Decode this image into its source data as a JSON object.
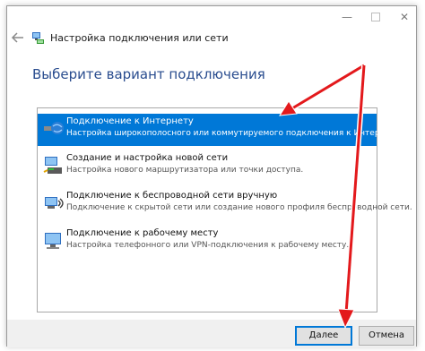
{
  "window": {
    "title": "Настройка подключения или сети",
    "controls": {
      "minimize": "—",
      "close": "✕"
    }
  },
  "heading": "Выберите вариант подключения",
  "options": [
    {
      "title": "Подключение к Интернету",
      "description": "Настройка широкополосного или коммутируемого подключения к Интернету.",
      "selected": true,
      "icon": "globe-icon"
    },
    {
      "title": "Создание и настройка новой сети",
      "description": "Настройка нового маршрутизатора или точки доступа.",
      "selected": false,
      "icon": "router-icon"
    },
    {
      "title": "Подключение к беспроводной сети вручную",
      "description": "Подключение к скрытой сети или создание нового профиля беспроводной сети.",
      "selected": false,
      "icon": "wireless-icon"
    },
    {
      "title": "Подключение к рабочему месту",
      "description": "Настройка телефонного или VPN-подключения к рабочему месту.",
      "selected": false,
      "icon": "workplace-icon"
    }
  ],
  "buttons": {
    "next": "Далее",
    "cancel": "Отмена"
  },
  "colors": {
    "selection": "#0078d7",
    "heading": "#2a4d8f",
    "arrow": "#e3191c"
  }
}
